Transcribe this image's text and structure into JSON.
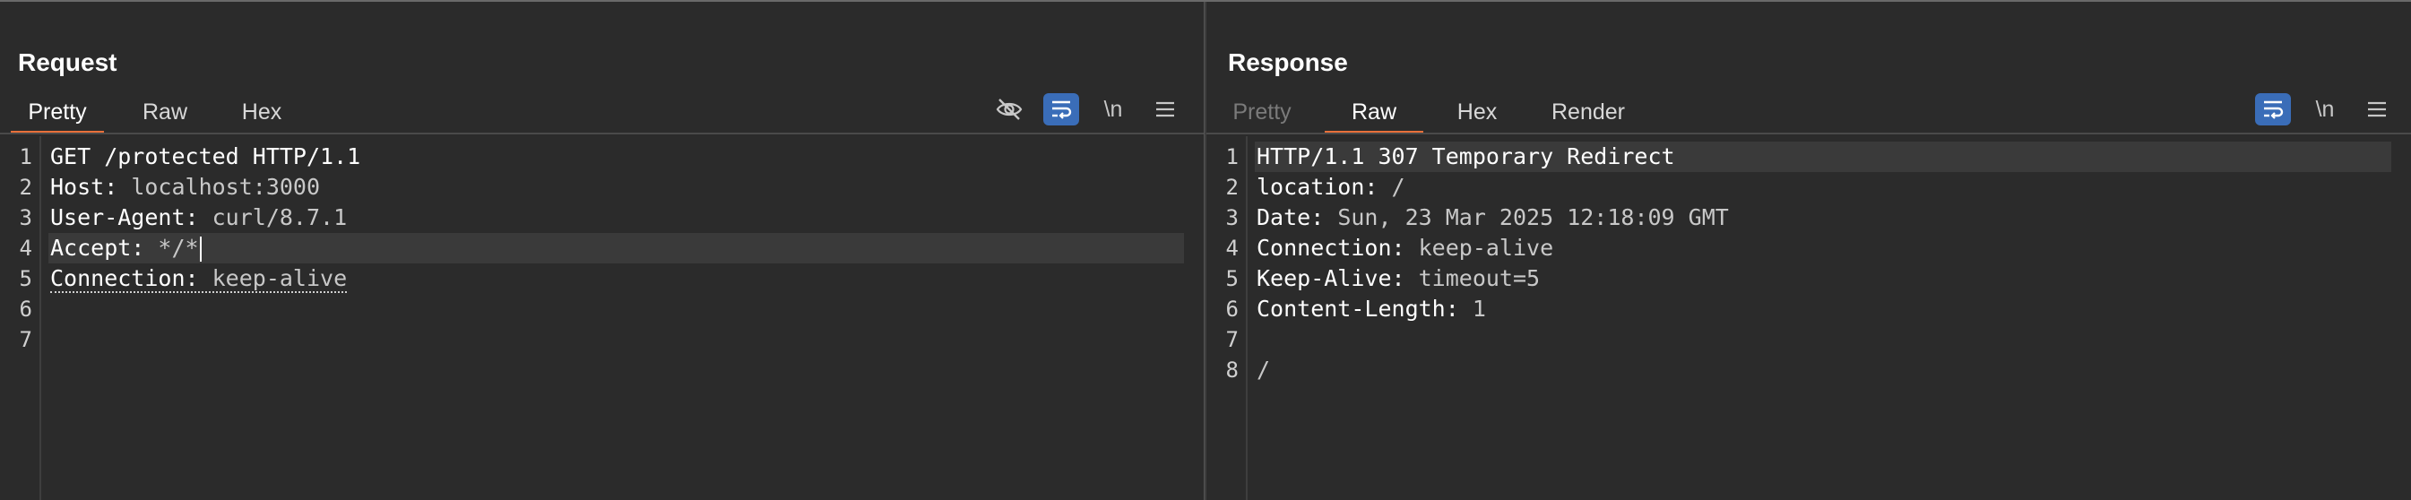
{
  "request": {
    "title": "Request",
    "tabs": [
      "Pretty",
      "Raw",
      "Hex"
    ],
    "active_tab": "Pretty",
    "tools": {
      "newline_label": "\\n"
    },
    "lines": [
      {
        "n": "1",
        "key": "GET /protected HTTP/1.1",
        "val": ""
      },
      {
        "n": "2",
        "key": "Host:",
        "val": " localhost:3000"
      },
      {
        "n": "3",
        "key": "User-Agent:",
        "val": " curl/8.7.1"
      },
      {
        "n": "4",
        "key": "Accept:",
        "val": " */*"
      },
      {
        "n": "5",
        "key": "Connection:",
        "val": " keep-alive"
      },
      {
        "n": "6",
        "key": "",
        "val": ""
      },
      {
        "n": "7",
        "key": "",
        "val": ""
      }
    ]
  },
  "response": {
    "title": "Response",
    "tabs": [
      "Pretty",
      "Raw",
      "Hex",
      "Render"
    ],
    "active_tab": "Raw",
    "tools": {
      "newline_label": "\\n"
    },
    "lines": [
      {
        "n": "1",
        "key": "HTTP/1.1 307 Temporary Redirect",
        "val": ""
      },
      {
        "n": "2",
        "key": "location:",
        "val": " /"
      },
      {
        "n": "3",
        "key": "Date:",
        "val": " Sun, 23 Mar 2025 12:18:09 GMT"
      },
      {
        "n": "4",
        "key": "Connection:",
        "val": " keep-alive"
      },
      {
        "n": "5",
        "key": "Keep-Alive:",
        "val": " timeout=5"
      },
      {
        "n": "6",
        "key": "Content-Length:",
        "val": " 1"
      },
      {
        "n": "7",
        "key": "",
        "val": ""
      },
      {
        "n": "8",
        "key": "/",
        "val": ""
      }
    ]
  },
  "colors": {
    "accent": "#e8703a",
    "toggle_on": "#3a6db8",
    "background": "#2b2b2b"
  },
  "icons": [
    "eye-slash-icon",
    "wrap-lines-icon",
    "newline-icon",
    "menu-icon",
    "layout-split-vertical-icon",
    "layout-split-horizontal-icon",
    "layout-single-icon"
  ]
}
